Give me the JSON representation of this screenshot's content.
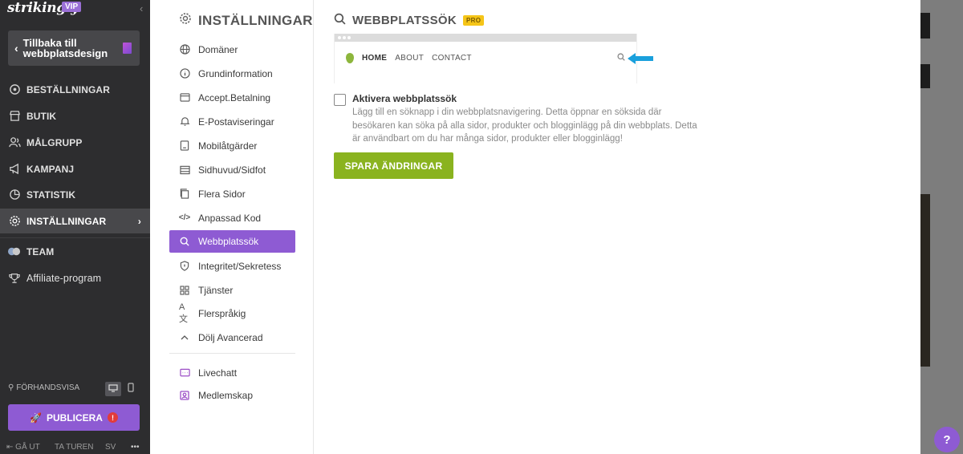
{
  "brand": {
    "logo": "strikingly",
    "badge": "VIP"
  },
  "sidebar": {
    "back_label": "Tillbaka till webbplatsdesign",
    "items": [
      {
        "label": "BESTÄLLNINGAR",
        "icon": "cart-icon"
      },
      {
        "label": "BUTIK",
        "icon": "store-icon"
      },
      {
        "label": "MÅLGRUPP",
        "icon": "audience-icon"
      },
      {
        "label": "KAMPANJ",
        "icon": "megaphone-icon"
      },
      {
        "label": "STATISTIK",
        "icon": "chart-icon"
      },
      {
        "label": "INSTÄLLNINGAR",
        "icon": "gear-icon",
        "active": true
      },
      {
        "label": "TEAM",
        "icon": "team-icon"
      },
      {
        "label": "Affiliate-program",
        "icon": "trophy-icon"
      }
    ],
    "preview_label": "FÖRHANDSVISA",
    "publish_label": "PUBLICERA",
    "publish_warning": "!",
    "footer": {
      "logout": "GÅ UT",
      "tour": "TA TUREN",
      "lang": "SV",
      "more": "•••"
    }
  },
  "settings": {
    "title": "INSTÄLLNINGAR",
    "items": [
      {
        "label": "Domäner",
        "icon": "globe-icon"
      },
      {
        "label": "Grundinformation",
        "icon": "info-icon"
      },
      {
        "label": "Accept.Betalning",
        "icon": "card-icon"
      },
      {
        "label": "E-Postaviseringar",
        "icon": "bell-icon"
      },
      {
        "label": "Mobilåtgärder",
        "icon": "mobile-icon"
      },
      {
        "label": "Sidhuvud/Sidfot",
        "icon": "layout-icon"
      },
      {
        "label": "Flera Sidor",
        "icon": "pages-icon"
      },
      {
        "label": "Anpassad Kod",
        "icon": "code-icon"
      },
      {
        "label": "Webbplatssök",
        "icon": "search-icon",
        "active": true
      },
      {
        "label": "Integritet/Sekretess",
        "icon": "shield-icon"
      },
      {
        "label": "Tjänster",
        "icon": "grid-icon"
      },
      {
        "label": "Flerspråkig",
        "icon": "translate-icon"
      },
      {
        "label": "Dölj Avancerad",
        "icon": "chevron-up-icon"
      }
    ],
    "extra_items": [
      {
        "label": "Livechatt",
        "icon": "chat-icon"
      },
      {
        "label": "Medlemskap",
        "icon": "member-icon"
      }
    ]
  },
  "content": {
    "title": "WEBBPLATSSÖK",
    "badge": "PRO",
    "mock": {
      "links": [
        "HOME",
        "ABOUT",
        "CONTACT"
      ]
    },
    "checkbox_label": "Aktivera webbplatssök",
    "checkbox_checked": false,
    "description": "Lägg till en söknapp i din webbplatsnavigering. Detta öppnar en söksida där besökaren kan söka på alla sidor, produkter och blogginlägg på din webbplats. Detta är användbart om du har många sidor, produkter eller blogginlägg!",
    "save_label": "SPARA ÄNDRINGAR"
  },
  "help": "?",
  "colors": {
    "accent": "#8e5bd3",
    "save": "#8ab31f",
    "sidebar": "#2d2d2f",
    "pro": "#f5c518",
    "arrow": "#1aa0dc"
  }
}
